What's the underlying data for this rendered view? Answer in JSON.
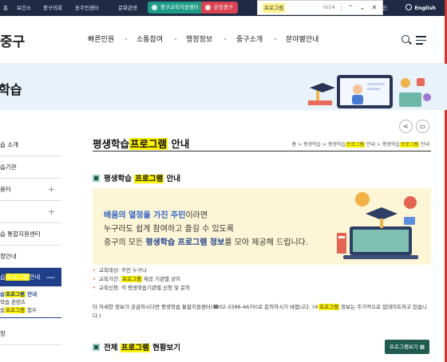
{
  "topbar": {
    "items": [
      "홈",
      "보건소",
      "중구의회",
      "동주민센터",
      "문화관광"
    ],
    "edu_center": "중구교육지원센터",
    "eunpa": "은동중구",
    "login": "그인",
    "lang": "English",
    "colors": {
      "bg": "#1f2a44",
      "green": "#1e9c88",
      "red": "#d94352"
    }
  },
  "find": {
    "query": "프로그램",
    "count": "0/14"
  },
  "header": {
    "logo": "중구",
    "nav": [
      "빠른민원",
      "소통참여",
      "행정정보",
      "중구소개",
      "분야별안내"
    ]
  },
  "banner": {
    "title": "학습"
  },
  "sidebar": {
    "items": [
      {
        "label": "습 소개",
        "plus": false
      },
      {
        "label": "습기관",
        "plus": false
      },
      {
        "label": "용터",
        "plus": true
      },
      {
        "label": "",
        "plus": true
      },
      {
        "label": "습 통합지원센터",
        "plus": false
      },
      {
        "label": "정안내",
        "plus": false
      }
    ],
    "active_pre": "습",
    "active_hl": "프로그램",
    "active_post": "안내",
    "active_sign": "—",
    "sub": [
      {
        "pre": "습",
        "hl": "프로그램",
        "post": " 안내",
        "on": true
      },
      {
        "pre": "학습 콘텐츠",
        "hl": "",
        "post": "",
        "on": false
      },
      {
        "pre": "습",
        "hl": "프로그램",
        "post": " 접수",
        "on": false
      }
    ],
    "last": "항"
  },
  "main": {
    "title_pre": "평생학습",
    "title_hl": "프로그램",
    "title_post": " 안내",
    "breadcrumb": {
      "home": "홈",
      "p1": "평생학습",
      "p2_pre": "평생학습",
      "p2_hl": "프로그램",
      "p2_post": " 안내",
      "p3_pre": "평생학습",
      "p3_hl": "프로그램",
      "p3_post": " 안내"
    },
    "section1": {
      "pre": "평생학습 ",
      "hl": "프로그램",
      "post": " 안내"
    },
    "box": {
      "l1_blue": "배움의 열정을 가진 주민",
      "l1_rest": "이라면",
      "l2": "누구라도 쉽게 참여하고 즐길 수 있도록",
      "l3_a": "중구의 모든 ",
      "l3_b": "평생학습 프로그램 정보",
      "l3_c": "를 모아 제공해 드립니다."
    },
    "bullets": [
      {
        "pre": "교육대상: 주민 누구나",
        "hl": "",
        "post": ""
      },
      {
        "pre": "교육기간: ",
        "hl": "프로그램",
        "post": " 제공 기관별 상이"
      },
      {
        "pre": "교육신청: 각 평생학습기관별 신청 및 문의",
        "hl": "",
        "post": ""
      }
    ],
    "note_a": "더 자세한 정보가 궁금하시다면 평생학습 통합지원센터(☎02-3396-4670)로 문의하시기 바랍니다. (※",
    "note_hl": "프로그램",
    "note_b": " 정보는 주기적으로 업데이트하고 있습니다.)",
    "section2": {
      "pre": "전체 ",
      "hl": "프로그램",
      "post": " 현황보기"
    },
    "list_btn": "프로그램보기"
  }
}
